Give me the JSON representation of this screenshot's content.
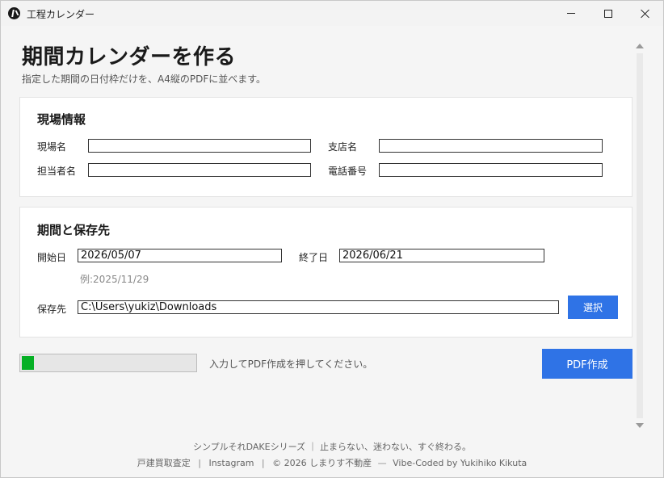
{
  "window": {
    "title": "工程カレンダー"
  },
  "header": {
    "title": "期間カレンダーを作る",
    "subtitle": "指定した期間の日付枠だけを、A4縦のPDFに並べます。"
  },
  "site_info": {
    "heading": "現場情報",
    "site_name_label": "現場名",
    "site_name_value": "",
    "branch_label": "支店名",
    "branch_value": "",
    "person_label": "担当者名",
    "person_value": "",
    "phone_label": "電話番号",
    "phone_value": ""
  },
  "period": {
    "heading": "期間と保存先",
    "start_label": "開始日",
    "start_value": "2026/05/07",
    "end_label": "終了日",
    "end_value": "2026/06/21",
    "example_hint": "例:2025/11/29",
    "save_label": "保存先",
    "save_value": "C:\\Users\\yukiz\\Downloads",
    "select_button": "選択"
  },
  "action": {
    "progress_fraction": 0.07,
    "status_text": "入力してPDF作成を押してください。",
    "pdf_button": "PDF作成"
  },
  "footer": {
    "tagline": "シンプルそれDAKEシリーズ ｜ 止まらない、迷わない、すぐ終わる。",
    "link_realestate": "戸建買取査定",
    "link_instagram": "Instagram",
    "copyright": "© 2026 しまりす不動産",
    "credit": "Vibe-Coded by Yukihiko Kikuta",
    "separator": "|"
  },
  "colors": {
    "accent": "#2f73e6",
    "progress": "#06b025"
  }
}
